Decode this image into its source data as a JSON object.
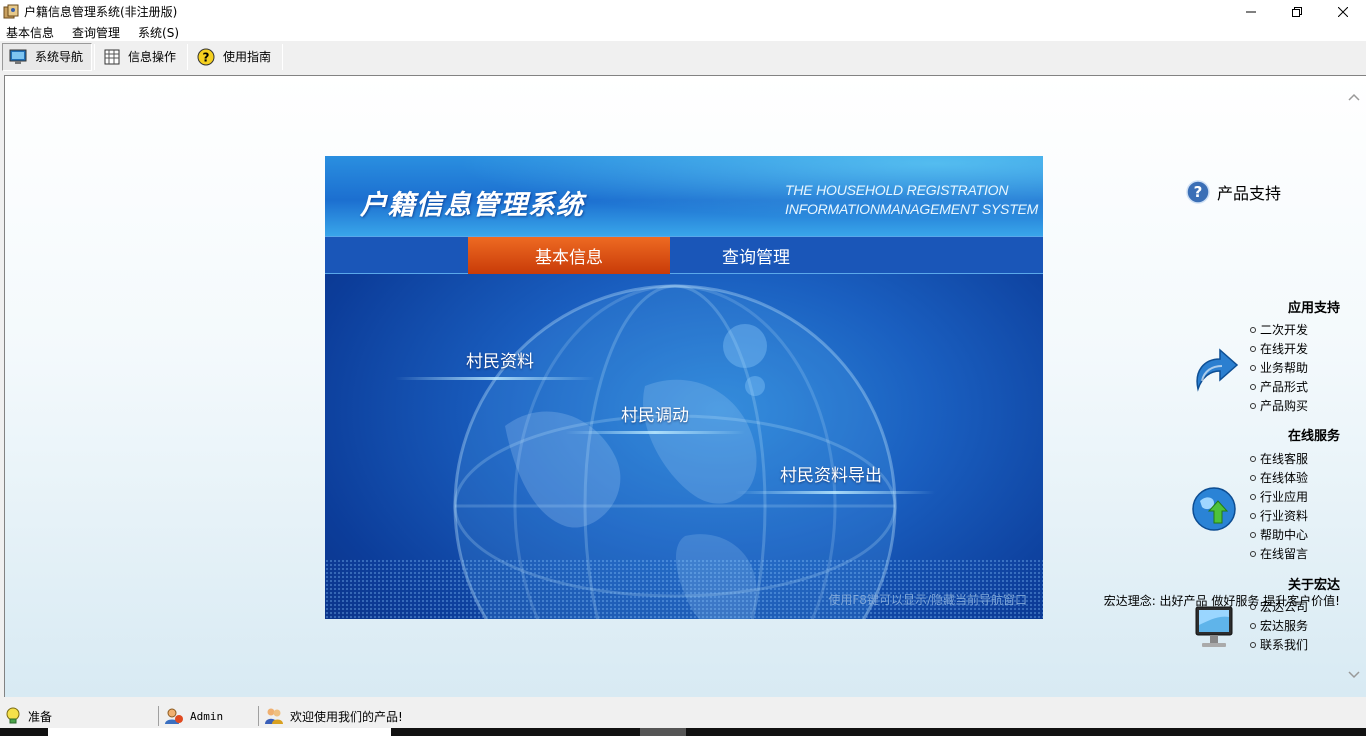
{
  "window": {
    "title": "户籍信息管理系统(非注册版)",
    "controls": [
      "minimize-icon",
      "restore-icon",
      "close-icon"
    ]
  },
  "menu": [
    "基本信息",
    "查询管理",
    "系统(S)"
  ],
  "toolbar": {
    "buttons": [
      {
        "label": "系统导航",
        "icon": "monitor-icon",
        "active": true
      },
      {
        "label": "信息操作",
        "icon": "grid-icon",
        "active": false
      },
      {
        "label": "使用指南",
        "icon": "help-icon",
        "active": false
      }
    ]
  },
  "panel": {
    "title": "户籍信息管理系统",
    "subtitle_line1": "THE HOUSEHOLD REGISTRATION",
    "subtitle_line2": "INFORMATIONMANAGEMENT SYSTEM",
    "tabs": [
      {
        "label": "基本信息",
        "active": true
      },
      {
        "label": "查询管理",
        "active": false
      }
    ],
    "links": [
      "村民资料",
      "村民调动",
      "村民资料导出"
    ],
    "hint": "使用F8键可以显示/隐藏当前导航窗口"
  },
  "support": {
    "heading": "产品支持",
    "sections": [
      {
        "title": "应用支持",
        "icon": "arrow-icon",
        "items": [
          "二次开发",
          "在线开发",
          "业务帮助",
          "产品形式",
          "产品购买"
        ]
      },
      {
        "title": "在线服务",
        "icon": "globe-icon",
        "items": [
          "在线客服",
          "在线体验",
          "行业应用",
          "行业资料",
          "帮助中心",
          "在线留言"
        ]
      },
      {
        "title": "关于宏达",
        "icon": "monitor-icon",
        "items": [
          "宏达公司",
          "宏达服务",
          "联系我们"
        ]
      }
    ],
    "motto": "宏达理念: 出好产品  做好服务  提升客户价值!"
  },
  "status": {
    "ready": "准备",
    "user": "Admin",
    "welcome": "欢迎使用我们的产品!"
  },
  "colors": {
    "panel_blue": "#1a5fc0",
    "tab_active": "#d9470f",
    "tab_bar": "#1a56b8"
  }
}
